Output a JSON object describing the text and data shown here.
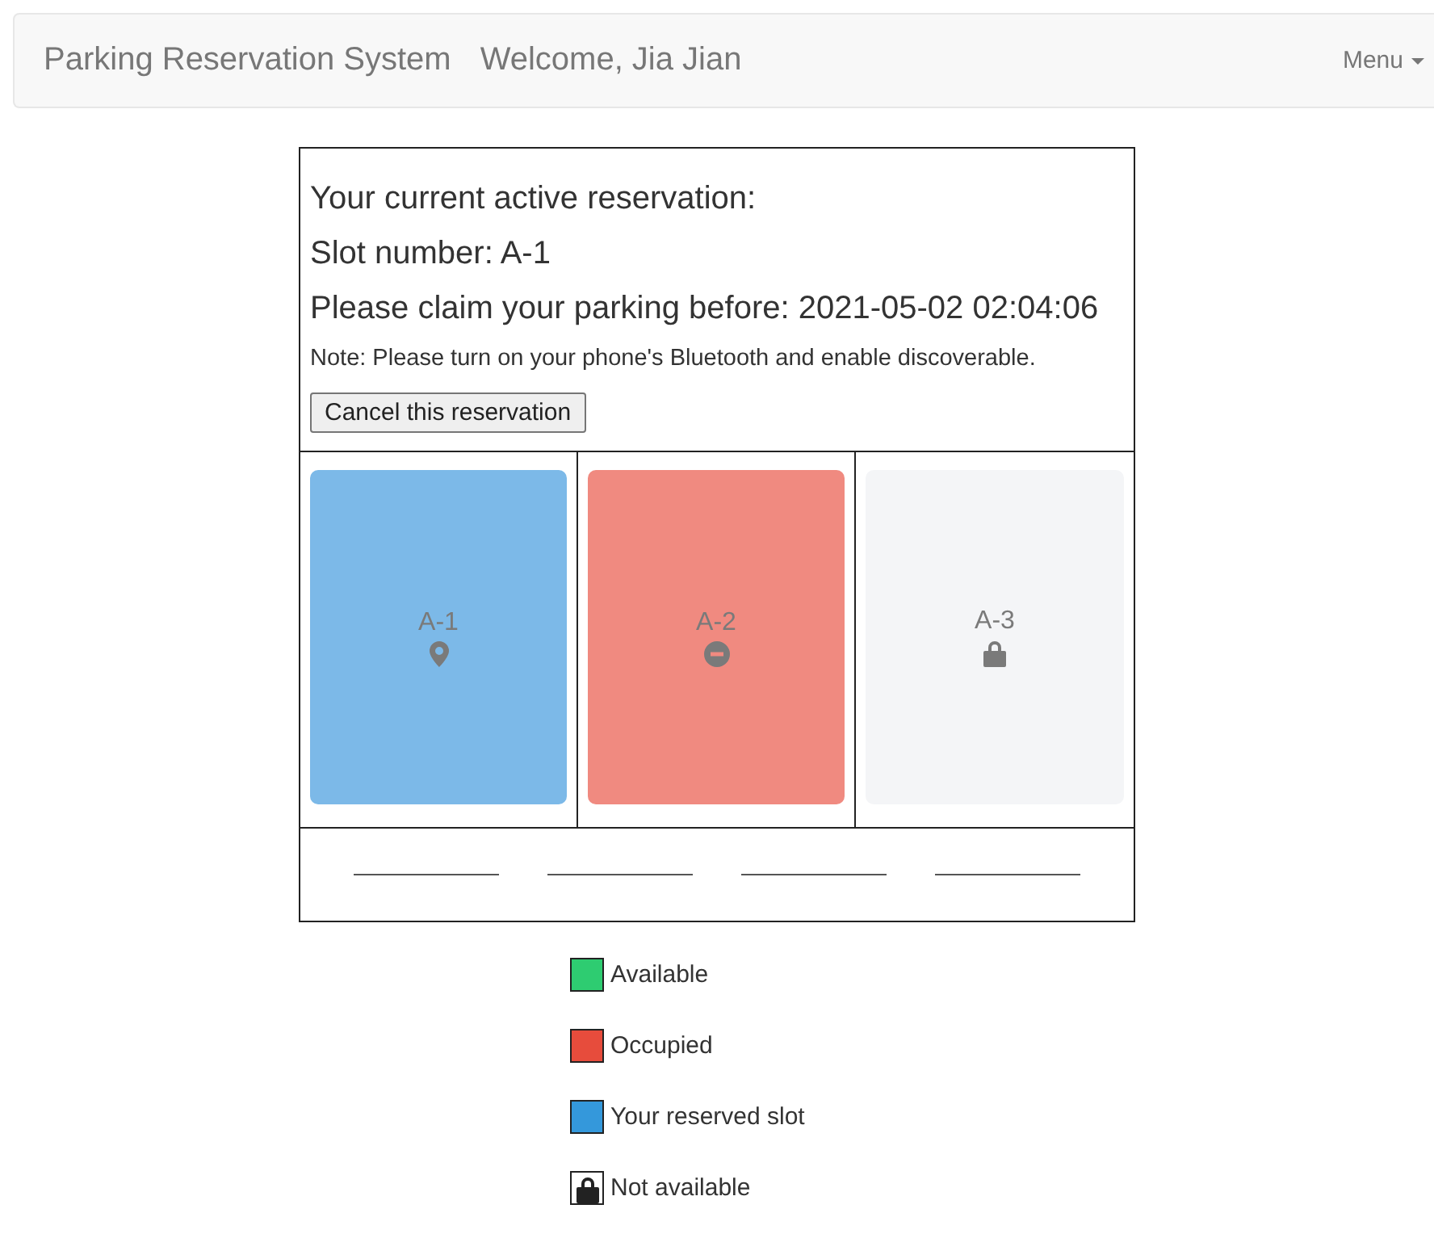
{
  "navbar": {
    "brand": "Parking Reservation System",
    "welcome": "Welcome, Jia Jian",
    "menu": "Menu"
  },
  "reservation": {
    "heading": "Your current active reservation:",
    "slot": "Slot number: A-1",
    "deadline": "Please claim your parking before: 2021-05-02 02:04:06",
    "note": "Note: Please turn on your phone's Bluetooth and enable discoverable.",
    "cancel_button": "Cancel this reservation"
  },
  "slots": [
    {
      "label": "A-1",
      "kind": "reserved",
      "color": "#7cb9e8"
    },
    {
      "label": "A-2",
      "kind": "occupied",
      "color": "#f08a80"
    },
    {
      "label": "A-3",
      "kind": "unavailable",
      "color": "#f4f5f7"
    }
  ],
  "legend": [
    {
      "label": "Available",
      "kind": "swatch",
      "color": "#2ecc71"
    },
    {
      "label": "Occupied",
      "kind": "swatch",
      "color": "#e74c3c"
    },
    {
      "label": "Your reserved slot",
      "kind": "swatch",
      "color": "#3498db"
    },
    {
      "label": "Not available",
      "kind": "lock"
    }
  ]
}
